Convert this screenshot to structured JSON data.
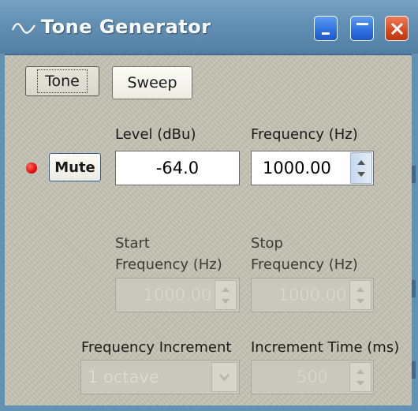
{
  "window": {
    "title": "Tone Generator",
    "icon": "sine-wave-icon",
    "controls": {
      "minimize": "minimize-icon",
      "maximize": "maximize-icon",
      "close": "close-icon"
    },
    "colors": {
      "titlebar": "#6391b4",
      "body": "#c4c3b5",
      "close": "#d6491f",
      "min_max": "#2d6fe0",
      "led": "#e30d0d"
    }
  },
  "mode_tabs": {
    "tone": "Tone",
    "sweep": "Sweep",
    "selected": "Tone"
  },
  "tone": {
    "mute_label": "Mute",
    "mute_indicator": "red-led-icon",
    "level_label": "Level (dBu)",
    "level_value": "-64.0",
    "frequency_label": "Frequency (Hz)",
    "frequency_value": "1000.00"
  },
  "sweep": {
    "start_label_line1": "Start",
    "start_label_line2": "Frequency (Hz)",
    "start_value": "1000.00",
    "stop_label_line1": "Stop",
    "stop_label_line2": "Frequency (Hz)",
    "stop_value": "1000.00",
    "increment_label": "Frequency Increment",
    "increment_value": "1 octave",
    "increment_time_label": "Increment Time (ms)",
    "increment_time_value": "500"
  }
}
